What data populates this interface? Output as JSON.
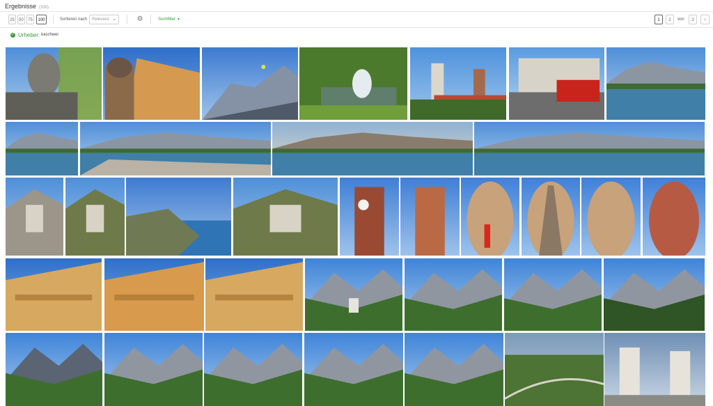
{
  "header": {
    "title": "Ergebnisse",
    "count": "(330)"
  },
  "toolbar": {
    "page_sizes": [
      "25",
      "50",
      "75",
      "100"
    ],
    "active_page_size": "100",
    "sort_label": "Sortieren nach",
    "sort_value": "Relevanz",
    "filter_label": "Suchfilter",
    "pages": [
      "1",
      "2"
    ],
    "active_page": "1",
    "of_label": "von",
    "total_pages": "3",
    "next_icon": "chevron-right-icon",
    "settings_icon": "gear-icon"
  },
  "active_filter": {
    "key": "Urheber:",
    "value": "kaschwei",
    "icon": "check-circle-icon"
  },
  "colors": {
    "accent_green": "#3d9a3d",
    "sky": "#5d94d6",
    "water": "#3f7fa8",
    "foliage": "#4f7d33",
    "ochre": "#d8a257"
  },
  "gallery": {
    "rows": [
      [
        {
          "name": "photo-statue-portrait",
          "scene": "statue"
        },
        {
          "name": "photo-church-dome-facade",
          "scene": "dome-facade"
        },
        {
          "name": "photo-mountain-paraglider",
          "scene": "mountains-sky"
        },
        {
          "name": "photo-park-fountain",
          "scene": "fountain"
        },
        {
          "name": "photo-church-towers",
          "scene": "towers-green"
        },
        {
          "name": "photo-city-red-bus",
          "scene": "street-bus"
        },
        {
          "name": "photo-coastal-mountains",
          "scene": "coast"
        }
      ],
      [
        {
          "name": "photo-panorama-bay-1",
          "scene": "coast"
        },
        {
          "name": "photo-panorama-rocks",
          "scene": "coast-rocks"
        },
        {
          "name": "photo-panorama-sunset",
          "scene": "coast-warm"
        },
        {
          "name": "photo-panorama-bay-2",
          "scene": "coast"
        }
      ],
      [
        {
          "name": "photo-stone-bell-tower",
          "scene": "stone-tower"
        },
        {
          "name": "photo-hill-chapel",
          "scene": "hill-chapel"
        },
        {
          "name": "photo-mountain-sea",
          "scene": "mountain-sea"
        },
        {
          "name": "photo-chapel-hillside",
          "scene": "hillside-chapel"
        },
        {
          "name": "photo-clock-tower",
          "scene": "clock-tower"
        },
        {
          "name": "photo-brick-bell-tower",
          "scene": "brick-tower"
        },
        {
          "name": "photo-dome-red-figure",
          "scene": "dome-figure"
        },
        {
          "name": "photo-spire-statue",
          "scene": "spire"
        },
        {
          "name": "photo-dome-columns",
          "scene": "dome-columns"
        },
        {
          "name": "photo-dome-red-roof",
          "scene": "dome-red"
        }
      ],
      [
        {
          "name": "photo-colonnade-tower",
          "scene": "colonnade"
        },
        {
          "name": "photo-ochre-balconies",
          "scene": "balconies"
        },
        {
          "name": "photo-baroque-facade",
          "scene": "baroque"
        },
        {
          "name": "photo-alpine-village",
          "scene": "alpine-village"
        },
        {
          "name": "photo-alpine-valley-1",
          "scene": "alpine-valley"
        },
        {
          "name": "photo-alpine-valley-2",
          "scene": "alpine-valley"
        },
        {
          "name": "photo-alpine-valley-3",
          "scene": "alpine-valley-dark"
        }
      ],
      [
        {
          "name": "photo-rocky-peak",
          "scene": "rocky-peak"
        },
        {
          "name": "photo-forest-ridge-1",
          "scene": "forest-ridge"
        },
        {
          "name": "photo-forest-ridge-2",
          "scene": "forest-ridge"
        },
        {
          "name": "photo-forest-ridge-3",
          "scene": "forest-ridge"
        },
        {
          "name": "photo-forest-ridge-4",
          "scene": "forest-ridge"
        },
        {
          "name": "photo-aerial-valley",
          "scene": "aerial-valley"
        },
        {
          "name": "photo-twin-towers-square",
          "scene": "twin-towers"
        }
      ]
    ]
  }
}
